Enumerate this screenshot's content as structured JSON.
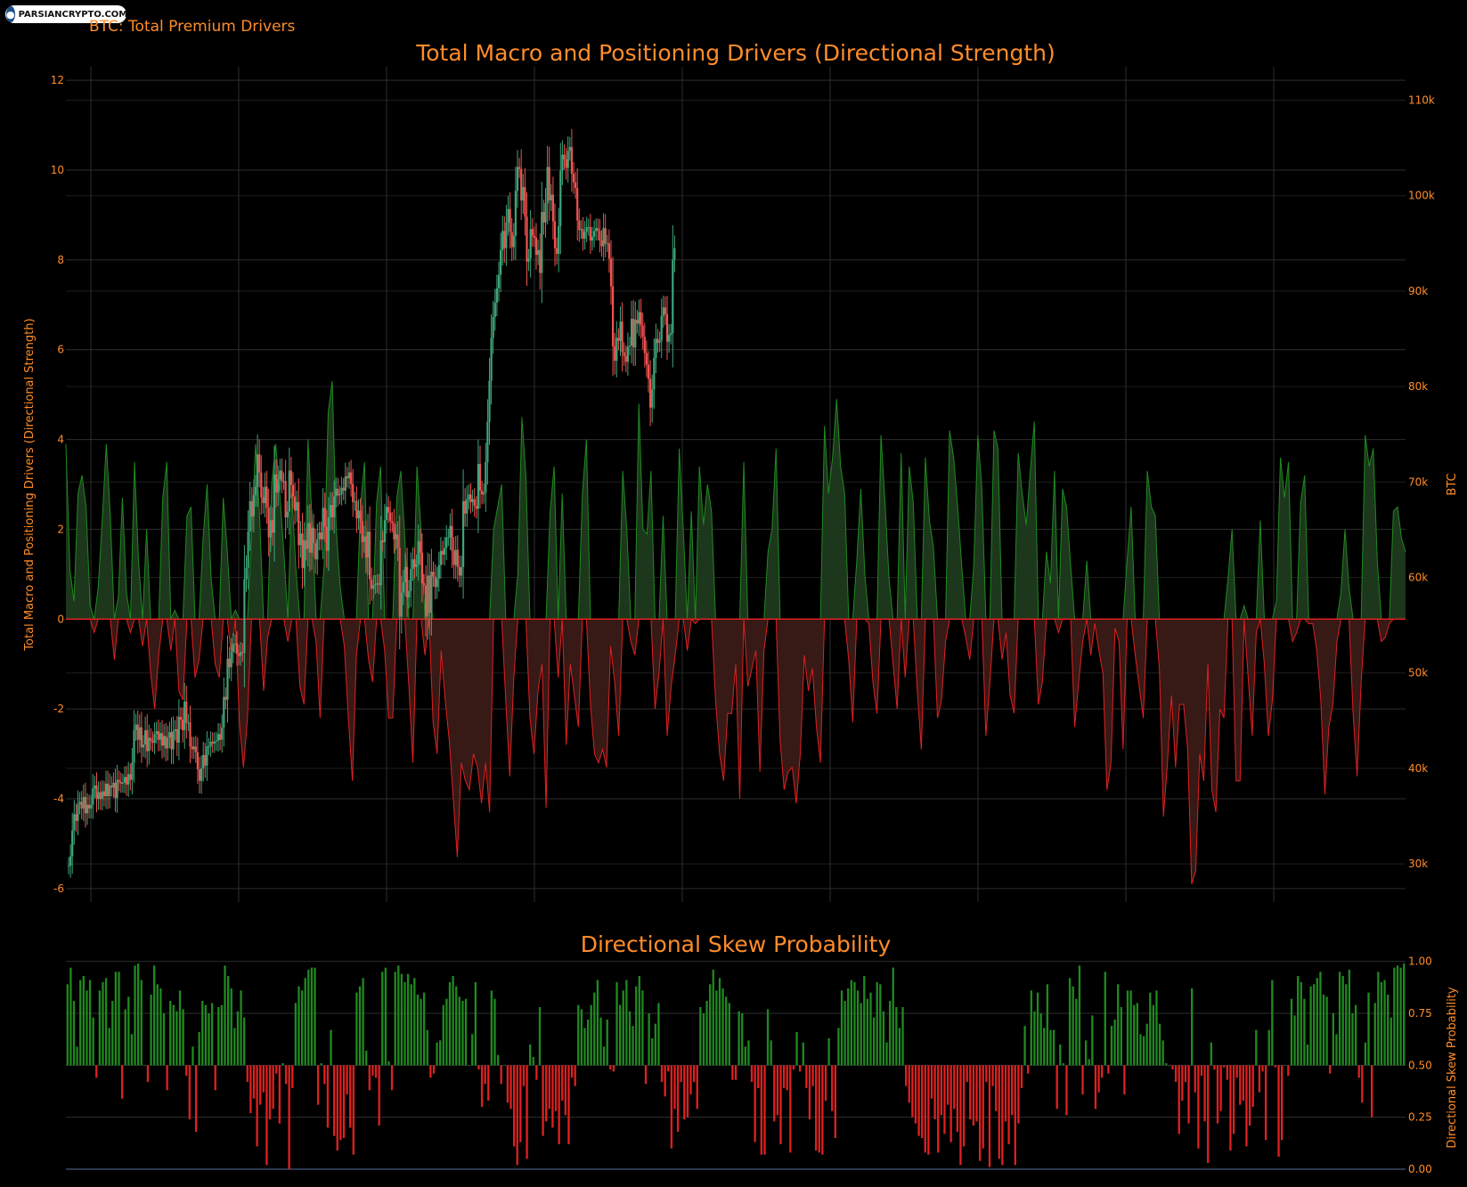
{
  "brand": {
    "logo_text": "PARSIANCRYPTO.COM",
    "logo_icon": "globe-icon"
  },
  "header": {
    "subtitle": "BTC: Total Premium Drivers"
  },
  "colors": {
    "background": "#000000",
    "text": "#ff8c2a",
    "grid": "#2e2e2e",
    "pos": "#1f8a1f",
    "neg": "#e02020",
    "pos_fill": "#1d3a1d",
    "neg_fill": "#3a1a17",
    "candle_up": "#3fa67a",
    "candle_down": "#ef5350"
  },
  "chart_data": [
    {
      "type": "area",
      "title": "Total Macro and Positioning Drivers (Directional Strength)",
      "ylabel": "Total Macro and Positioning Drivers (Directional Strength)",
      "ylim": [
        -6.3,
        12.3
      ],
      "yticks": [
        -6,
        -4,
        -2,
        0,
        2,
        4,
        6,
        8,
        10,
        12
      ],
      "y2label": "BTC",
      "y2lim": [
        26000,
        113500
      ],
      "y2ticks": [
        30000,
        40000,
        50000,
        60000,
        70000,
        80000,
        90000,
        100000,
        110000
      ],
      "y2ticklabels": [
        "30k",
        "40k",
        "50k",
        "60k",
        "70k",
        "80k",
        "90k",
        "100k",
        "110k"
      ],
      "grid": true,
      "series": [
        {
          "name": "",
          "values": [
            3.9,
            1.1,
            0.4,
            2.8,
            3.2,
            2.5,
            0.3,
            -0.3,
            0.7,
            2.2,
            3.9,
            2.3,
            -0.9,
            0.5,
            2.7,
            0.6,
            -0.3,
            3.5,
            1.3,
            -0.6,
            2.0,
            -1.2,
            -2.0,
            -0.8,
            2.7,
            3.5,
            -0.7,
            0.2,
            -1.6,
            -1.8,
            2.3,
            2.5,
            -1.3,
            -0.9,
            1.8,
            3.0,
            0.9,
            -1.0,
            -1.3,
            2.7,
            1.5,
            -0.8,
            0.2,
            -2.3,
            -3.3,
            -2.2,
            1.8,
            3.9,
            2.3,
            -1.6,
            -0.4,
            3.0,
            3.9,
            2.8,
            1.5,
            -0.5,
            2.8,
            1.1,
            -1.5,
            -1.9,
            4.0,
            2.2,
            -0.5,
            -2.2,
            1.2,
            4.6,
            5.3,
            2.0,
            0.7,
            -0.6,
            -2.2,
            -3.6,
            -0.8,
            2.5,
            3.5,
            -0.9,
            -1.4,
            2.6,
            3.4,
            -0.7,
            -2.2,
            -2.2,
            2.7,
            3.3,
            1.8,
            -1.5,
            -3.2,
            3.4,
            2.0,
            -0.8,
            0.6,
            -2.3,
            -3.0,
            -0.7,
            -1.8,
            -2.7,
            -4.0,
            -5.3,
            -3.2,
            -3.6,
            -3.8,
            -3.0,
            -3.3,
            -4.1,
            -3.2,
            -4.3,
            2.0,
            2.5,
            3.0,
            -1.8,
            -3.5,
            -1.3,
            1.0,
            4.5,
            3.2,
            -2.2,
            -3.0,
            -1.6,
            -1.0,
            -4.2,
            2.4,
            3.4,
            -1.3,
            2.8,
            -2.8,
            -1.0,
            -1.7,
            -2.4,
            2.8,
            4.0,
            -1.9,
            -3.0,
            -3.2,
            -2.9,
            -3.3,
            -0.6,
            -1.4,
            -2.6,
            3.3,
            2.0,
            -0.5,
            -0.8,
            4.8,
            2.0,
            1.9,
            3.3,
            -2.0,
            -1.2,
            2.3,
            -2.6,
            -1.5,
            -0.8,
            3.8,
            2.0,
            -0.7,
            2.4,
            -0.1,
            3.4,
            2.1,
            3.0,
            2.4,
            -1.8,
            -3.0,
            -3.6,
            -2.1,
            -2.1,
            -1.0,
            -4.0,
            3.5,
            -1.5,
            -1.1,
            -0.7,
            -3.4,
            -0.7,
            1.5,
            2.0,
            3.8,
            -2.7,
            -3.8,
            -3.4,
            -3.3,
            -4.1,
            -3.0,
            -0.8,
            -1.6,
            -1.1,
            -2.4,
            -3.2,
            4.3,
            2.8,
            3.6,
            4.9,
            3.4,
            2.8,
            -0.9,
            -2.3,
            1.3,
            2.9,
            1.0,
            -0.1,
            -1.4,
            -2.1,
            4.1,
            2.6,
            0.9,
            -1.0,
            -2.0,
            3.7,
            -1.3,
            3.4,
            2.6,
            -1.6,
            -2.9,
            3.6,
            2.2,
            1.6,
            -2.2,
            -1.8,
            -0.5,
            4.2,
            3.6,
            2.5,
            1.2,
            -0.4,
            -0.9,
            1.2,
            4.1,
            2.9,
            -2.6,
            -1.4,
            4.2,
            3.8,
            -0.9,
            -0.3,
            -1.7,
            -2.1,
            3.7,
            2.8,
            2.1,
            3.3,
            4.4,
            -1.9,
            -1.4,
            1.5,
            0.8,
            3.3,
            -0.3,
            2.9,
            2.5,
            1.2,
            -2.4,
            -1.4,
            -0.5,
            1.3,
            -0.8,
            -0.1,
            -0.7,
            -1.2,
            -3.8,
            -3.2,
            -0.2,
            -0.5,
            -2.9,
            1.3,
            2.5,
            -0.8,
            -1.5,
            -2.2,
            3.3,
            2.5,
            2.3,
            -1.1,
            -4.4,
            -3.2,
            -1.7,
            -3.3,
            -1.9,
            -1.9,
            -2.9,
            -5.9,
            -5.6,
            -3.0,
            -3.6,
            -1.0,
            -3.8,
            -4.3,
            -2.0,
            -2.2,
            0.9,
            2.0,
            -3.6,
            -3.6,
            0.3,
            -1.3,
            -2.6,
            -0.3,
            2.2,
            -1.0,
            -2.6,
            -1.8,
            0.4,
            3.6,
            2.7,
            3.5,
            -0.5,
            -0.3,
            2.6,
            3.2,
            -0.1,
            -0.1,
            -0.7,
            -1.8,
            -3.9,
            -2.4,
            -1.9,
            -0.5,
            0.6,
            2.0,
            0.7,
            -2.1,
            -3.5,
            -1.4,
            4.1,
            3.4,
            3.8,
            1.3,
            -0.5,
            -0.4,
            -0.1,
            2.4,
            2.5,
            1.8,
            1.5
          ]
        }
      ],
      "candles": {
        "name": "BTC",
        "x_start": 3.0,
        "x_step": 2.1,
        "close": [
          29800,
          30800,
          33500,
          35200,
          34500,
          36200,
          36500,
          35800,
          37000,
          35300,
          36200,
          35800,
          36200,
          37900,
          38200,
          36800,
          37500,
          36800,
          37600,
          37100,
          38400,
          37100,
          38200,
          38000,
          38500,
          36900,
          38800,
          38600,
          38400,
          38500,
          39100,
          38300,
          39400,
          38800,
          40600,
          44000,
          44600,
          43000,
          44300,
          42200,
          42500,
          44000,
          41800,
          43200,
          42900,
          42700,
          43600,
          43900,
          43000,
          43700,
          42400,
          43400,
          42100,
          43200,
          43800,
          42000,
          43900,
          44100,
          42700,
          45400,
          45100,
          44000,
          47000,
          44800,
          44800,
          42300,
          42000,
          42300,
          41700,
          39900,
          38700,
          40000,
          41400,
          40300,
          42300,
          42300,
          42800,
          42600,
          42800,
          42900,
          43600,
          43000,
          44300,
          47500,
          47200,
          51500,
          50600,
          52200,
          53000,
          53100,
          52000,
          51800,
          52200,
          52100,
          59800,
          61000,
          64800,
          68000,
          66400,
          68600,
          69500,
          72900,
          71000,
          68400,
          67800,
          69500,
          67300,
          64200,
          66000,
          64700,
          70800,
          68900,
          70300,
          71200,
          70100,
          70100,
          66300,
          66900,
          71200,
          69700,
          68500,
          67000,
          67900,
          63400,
          64600,
          61000,
          63900,
          63000,
          65700,
          62600,
          65200,
          63600,
          61900,
          64000,
          64700,
          64000,
          67300,
          65300,
          62800,
          66300,
          67600,
          66300,
          68500,
          69300,
          68600,
          68700,
          69400,
          69100,
          70600,
          70400,
          71000,
          69800,
          67900,
          68000,
          66200,
          67000,
          65900,
          63700,
          64300,
          62100,
          64800,
          59800,
          58800,
          59200,
          59300,
          59400,
          59200,
          63900,
          63700,
          66000,
          67400,
          66800,
          65900,
          65700,
          64000,
          64500,
          63100,
          55900,
          58400,
          59500,
          61100,
          57900,
          58600,
          60900,
          61900,
          61100,
          61400,
          63800,
          62600,
          59400,
          59200,
          55900,
          60200,
          56300,
          60600,
          60100,
          59000,
          59900,
          61300,
          62800,
          62400,
          63100,
          64200,
          64200,
          65400,
          62800,
          61300,
          62900,
          61100,
          60200,
          61100,
          68000,
          66700,
          68200,
          68700,
          67900,
          68200,
          67500,
          67200,
          71900,
          69100,
          68700,
          68900,
          72100,
          76300,
          80600,
          85100,
          87300,
          88800,
          90300,
          91700,
          94300,
          96300,
          94500,
          97200,
          98600,
          96200,
          94600,
          95800,
          100500,
          103000,
          102800,
          99500,
          100900,
          97800,
          93100,
          93400,
          96500,
          95800,
          95600,
          93800,
          94300,
          91900,
          98300,
          97200,
          99200,
          103000,
          99500,
          100100,
          97300,
          94500,
          93900,
          96800,
          102600,
          104300,
          103800,
          102900,
          104700,
          105100,
          102300,
          101400,
          100800,
          97400,
          96400,
          96500,
          95500,
          96200,
          96700,
          96700,
          95300,
          95700,
          96300,
          96600,
          96300,
          95300,
          94700,
          96600,
          95000,
          95000,
          93400,
          90500,
          84200,
          82700,
          85100,
          84800,
          86800,
          83600,
          83200,
          82600,
          84200,
          84300,
          87100,
          84100,
          87000,
          86600,
          87800,
          86400,
          85200,
          83500,
          82300,
          80800,
          77800,
          79700,
          83000,
          85000,
          84600,
          84800,
          87400,
          88300,
          87600,
          84700,
          85400,
          85600,
          93300,
          94500
        ],
        "up_color": "#3fa67a",
        "down_color": "#ef5350"
      }
    },
    {
      "type": "bar",
      "title": "Directional Skew Probability",
      "ylabel": "Directional Skew Probability",
      "ylim": [
        0,
        1.02
      ],
      "yticks": [
        0,
        0.25,
        0.5,
        0.75,
        1.0
      ],
      "yticklabels": [
        "0.00",
        "0.25",
        "0.50",
        "0.75",
        "1.00"
      ],
      "baseline": 0.5,
      "grid": true,
      "values": [
        0.89,
        0.97,
        0.81,
        0.59,
        0.91,
        0.93,
        0.86,
        0.91,
        0.73,
        0.44,
        0.86,
        0.9,
        0.92,
        0.68,
        0.81,
        0.95,
        0.95,
        0.34,
        0.77,
        0.83,
        0.65,
        0.98,
        0.99,
        0.91,
        0.5,
        0.42,
        0.84,
        0.98,
        0.89,
        0.87,
        0.75,
        0.38,
        0.81,
        0.79,
        0.76,
        0.86,
        0.77,
        0.45,
        0.24,
        0.59,
        0.18,
        0.66,
        0.81,
        0.79,
        0.75,
        0.8,
        0.38,
        0.78,
        0.79,
        0.98,
        0.93,
        0.87,
        0.68,
        0.76,
        0.86,
        0.73,
        0.42,
        0.27,
        0.34,
        0.11,
        0.31,
        0.37,
        0.02,
        0.24,
        0.29,
        0.46,
        0.22,
        0.51,
        0.41,
        0.0,
        0.39,
        0.8,
        0.88,
        0.86,
        0.92,
        0.96,
        0.97,
        0.97,
        0.31,
        0.51,
        0.41,
        0.2,
        0.67,
        0.16,
        0.09,
        0.14,
        0.15,
        0.36,
        0.2,
        0.07,
        0.85,
        0.88,
        0.92,
        0.57,
        0.38,
        0.45,
        0.44,
        0.21,
        0.95,
        0.97,
        0.52,
        0.38,
        0.95,
        0.98,
        0.94,
        0.9,
        0.94,
        0.89,
        0.92,
        0.84,
        0.82,
        0.85,
        0.67,
        0.44,
        0.46,
        0.61,
        0.62,
        0.79,
        0.82,
        0.9,
        0.93,
        0.88,
        0.83,
        0.81,
        0.82,
        0.5,
        0.65,
        0.9,
        0.48,
        0.3,
        0.41,
        0.33,
        0.86,
        0.82,
        0.55,
        0.41,
        0.5,
        0.32,
        0.29,
        0.11,
        0.02,
        0.13,
        0.4,
        0.05,
        0.6,
        0.54,
        0.43,
        0.78,
        0.16,
        0.23,
        0.29,
        0.2,
        0.28,
        0.12,
        0.33,
        0.26,
        0.12,
        0.44,
        0.4,
        0.79,
        0.77,
        0.68,
        0.72,
        0.79,
        0.85,
        0.91,
        0.73,
        0.59,
        0.72,
        0.48,
        0.47,
        0.9,
        0.79,
        0.86,
        0.91,
        0.76,
        0.69,
        0.88,
        0.93,
        0.86,
        0.41,
        0.75,
        0.63,
        0.7,
        0.8,
        0.42,
        0.35,
        0.47,
        0.1,
        0.29,
        0.18,
        0.42,
        0.24,
        0.25,
        0.36,
        0.42,
        0.29,
        0.78,
        0.75,
        0.81,
        0.89,
        0.96,
        0.86,
        0.92,
        0.87,
        0.83,
        0.8,
        0.43,
        0.43,
        0.76,
        0.75,
        0.59,
        0.62,
        0.42,
        0.13,
        0.39,
        0.07,
        0.07,
        0.77,
        0.62,
        0.23,
        0.26,
        0.12,
        0.39,
        0.38,
        0.08,
        0.48,
        0.66,
        0.47,
        0.61,
        0.39,
        0.24,
        0.4,
        0.09,
        0.08,
        0.07,
        0.33,
        0.63,
        0.28,
        0.15,
        0.68,
        0.86,
        0.81,
        0.87,
        0.91,
        0.9,
        0.86,
        0.8,
        0.93,
        0.82,
        0.85,
        0.73,
        0.9,
        0.89,
        0.76,
        0.61,
        0.81,
        0.97,
        0.78,
        0.68,
        0.78,
        0.4,
        0.32,
        0.25,
        0.22,
        0.16,
        0.15,
        0.08,
        0.07,
        0.34,
        0.24,
        0.08,
        0.26,
        0.17,
        0.31,
        0.13,
        0.29,
        0.18,
        0.02,
        0.11,
        0.42,
        0.24,
        0.21,
        0.23,
        0.04,
        0.1,
        0.42,
        0.01,
        0.4,
        0.28,
        0.05,
        0.02,
        0.23,
        0.12,
        0.26,
        0.02,
        0.22,
        0.39,
        0.69,
        0.46,
        0.86,
        0.76,
        0.85,
        0.75,
        0.68,
        0.89,
        0.67,
        0.67,
        0.29,
        0.6,
        0.51,
        0.26,
        0.92,
        0.88,
        0.82,
        0.98,
        0.36,
        0.62,
        0.53,
        0.74,
        0.29,
        0.37,
        0.44,
        0.95,
        0.46,
        0.69,
        0.72,
        0.89,
        0.78,
        0.36,
        0.86,
        0.86,
        0.79,
        0.8,
        0.65,
        0.64,
        0.7,
        0.85,
        0.79,
        0.86,
        0.7,
        0.62,
        0.51,
        0.5,
        0.48,
        0.42,
        0.17,
        0.33,
        0.42,
        0.22,
        0.87,
        0.37,
        0.1,
        0.45,
        0.23,
        0.03,
        0.61,
        0.48,
        0.22,
        0.28,
        0.49,
        0.43,
        0.09,
        0.17,
        0.44,
        0.31,
        0.33,
        0.11,
        0.21,
        0.3,
        0.67,
        0.37,
        0.47,
        0.14,
        0.67,
        0.91,
        0.49,
        0.06,
        0.14,
        0.5,
        0.45,
        0.82,
        0.74,
        0.93,
        0.9,
        0.82,
        0.6,
        0.88,
        0.89,
        0.92,
        0.95,
        0.84,
        0.83,
        0.46,
        0.75,
        0.65,
        0.95,
        0.93,
        0.89,
        0.96,
        0.75,
        0.79,
        0.44,
        0.32,
        0.61,
        0.85,
        0.25,
        0.8,
        0.95,
        0.9,
        0.91,
        0.84,
        0.73,
        0.97,
        0.98,
        0.97,
        0.99
      ]
    }
  ]
}
